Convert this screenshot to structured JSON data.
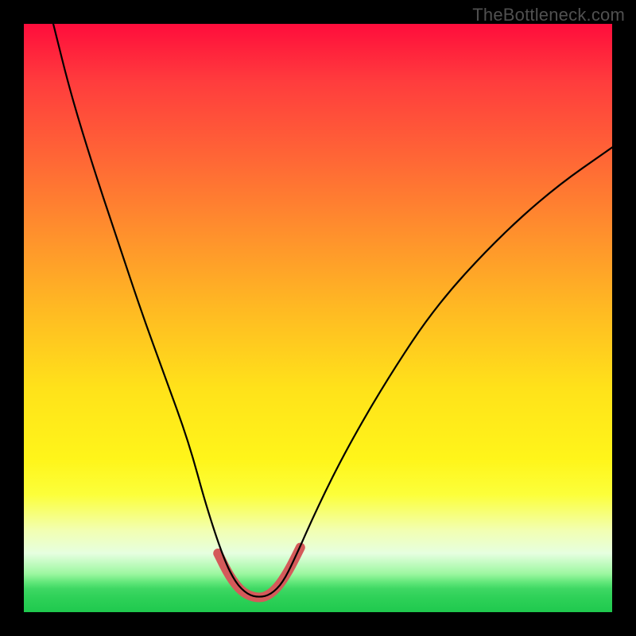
{
  "watermark": "TheBottleneck.com",
  "chart_data": {
    "type": "line",
    "title": "",
    "xlabel": "",
    "ylabel": "",
    "xlim": [
      0,
      100
    ],
    "ylim": [
      0,
      100
    ],
    "grid": false,
    "legend": false,
    "notes": "No visible axes, ticks, titles, or legend. A V-shaped bottleneck curve is plotted over a vertical rainbow gradient (red high → green low). The lowest (best) region of the curve is highlighted with a thick salmon stroke near the bottom around x≈34–45.",
    "series": [
      {
        "name": "bottleneck-curve",
        "x": [
          5,
          8,
          12,
          16,
          20,
          24,
          28,
          31,
          34,
          36,
          38,
          40,
          42,
          44,
          46,
          50,
          55,
          62,
          70,
          80,
          90,
          100
        ],
        "values": [
          100,
          88,
          75,
          63,
          51,
          40,
          29,
          18,
          9,
          5,
          3,
          2.5,
          3,
          5,
          9,
          18,
          28,
          40,
          52,
          63,
          72,
          79
        ]
      }
    ],
    "highlight": {
      "x": [
        33,
        35,
        37,
        39,
        41,
        43,
        45,
        47
      ],
      "values": [
        10,
        6,
        3.5,
        2.5,
        2.5,
        4,
        7,
        11
      ]
    },
    "colors": {
      "gradient_top": "#ff0d3c",
      "gradient_mid": "#ffe21a",
      "gradient_bottom": "#1fc94e",
      "curve": "#000000",
      "highlight": "#d45a5a",
      "frame": "#000000"
    }
  }
}
